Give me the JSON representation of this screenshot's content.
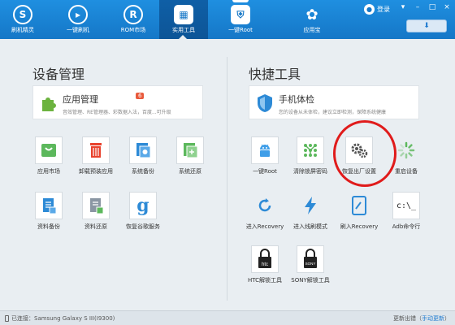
{
  "nav": {
    "items": [
      {
        "label": "刷机精灵",
        "glyph": "S"
      },
      {
        "label": "一键刷机",
        "glyph": "▸"
      },
      {
        "label": "ROM市场",
        "glyph": "R"
      },
      {
        "label": "实用工具",
        "glyph": "▦"
      },
      {
        "label": "一键Root",
        "glyph": "⛨"
      },
      {
        "label": "应用宝",
        "glyph": "✿"
      }
    ],
    "active_index": 3
  },
  "header": {
    "login_label": "登录",
    "download_glyph": "⬇"
  },
  "left": {
    "title": "设备管理",
    "banner": {
      "title": "应用管理",
      "badge": "6",
      "subtitle": "音效管理、RE管理器、彩数据入法，百度...可升级"
    },
    "tools": [
      {
        "label": "应用市场",
        "icon": "shop-bag-icon"
      },
      {
        "label": "卸载预装应用",
        "icon": "trash-icon"
      },
      {
        "label": "系统备份",
        "icon": "system-backup-icon"
      },
      {
        "label": "系统还原",
        "icon": "system-restore-icon"
      },
      {
        "label": "资料备份",
        "icon": "data-backup-icon"
      },
      {
        "label": "资料还原",
        "icon": "data-restore-icon"
      },
      {
        "label": "恢复谷歌服务",
        "icon": "google-icon"
      }
    ]
  },
  "right": {
    "title": "快捷工具",
    "banner": {
      "title": "手机体检",
      "subtitle": "您的设备从未体检，建议立即检测，保障系统健康"
    },
    "tools": [
      {
        "label": "一键Root",
        "icon": "android-root-icon"
      },
      {
        "label": "清除锁屏密码",
        "icon": "pattern-lock-icon"
      },
      {
        "label": "恢复出厂设置",
        "icon": "gears-icon"
      },
      {
        "label": "重启设备",
        "icon": "reboot-spinner-icon"
      },
      {
        "label": "进入Recovery",
        "icon": "recovery-arrow-icon"
      },
      {
        "label": "进入线刷模式",
        "icon": "lightning-icon"
      },
      {
        "label": "刷入Recovery",
        "icon": "flash-recovery-icon"
      },
      {
        "label": "Adb命令行",
        "icon": "terminal-icon"
      },
      {
        "label": "HTC解锁工具",
        "icon": "htc-lock-icon",
        "brand": "htc"
      },
      {
        "label": "SONY解锁工具",
        "icon": "sony-lock-icon",
        "brand": "SONY"
      }
    ],
    "terminal_text": "c:\\_"
  },
  "status": {
    "connection": "已连接：Samsung Galaxy S III(I9300)",
    "update_prefix": "更新出错（",
    "update_link": "手动更新",
    "update_suffix": "）"
  },
  "colors": {
    "accent": "#1577c7",
    "highlight": "#e01b1b",
    "green": "#4caf50"
  }
}
